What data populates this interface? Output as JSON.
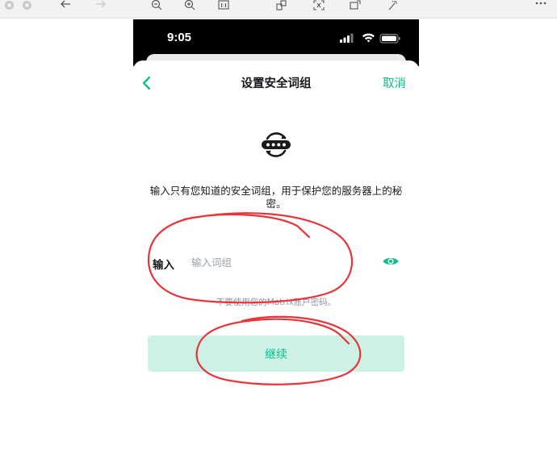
{
  "toolbar": {
    "icons": [
      "close-icon",
      "close-icon",
      "back-arrow-icon",
      "forward-arrow-icon",
      "zoom-out-icon",
      "zoom-in-icon",
      "actual-size-icon",
      "share-icon",
      "translate-icon",
      "rotate-icon",
      "markup-icon",
      "more-icon"
    ]
  },
  "status_bar": {
    "time": "9:05"
  },
  "nav": {
    "title": "设置安全词组",
    "cancel": "取消"
  },
  "description": "输入只有您知道的安全词组，用于保护您的服务器上的秘密。",
  "field": {
    "label": "输入",
    "placeholder": "输入词组",
    "value": ""
  },
  "hint": "不要使用您的Matrix账户密码。",
  "continue_button": "继续",
  "colors": {
    "accent": "#0dbd8b",
    "button_bg": "#cdf2e5",
    "annotation": "#e8343a"
  }
}
